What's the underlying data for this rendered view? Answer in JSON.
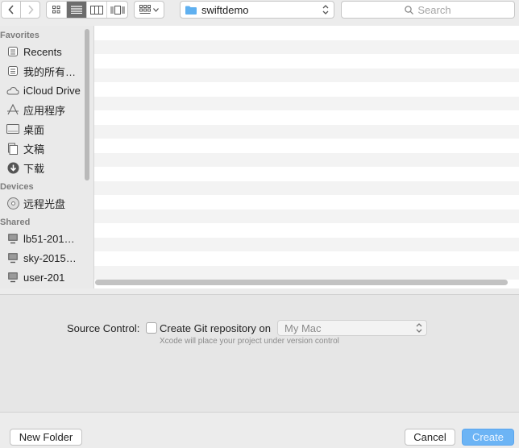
{
  "toolbar": {
    "back_icon": "chevron-left-icon",
    "forward_icon": "chevron-right-icon",
    "view_modes": [
      "icon-view-icon",
      "list-view-icon",
      "column-view-icon",
      "coverflow-view-icon"
    ],
    "active_view": "list-view-icon",
    "arrange_icon": "grid-arrange-icon",
    "path_label": "swiftdemo",
    "search_placeholder": "Search"
  },
  "sidebar": {
    "sections": [
      {
        "title": "Favorites",
        "items": [
          {
            "label": "Recents",
            "icon": "recents-icon"
          },
          {
            "label": "我的所有…",
            "icon": "all-files-icon"
          },
          {
            "label": "iCloud Drive",
            "icon": "cloud-icon"
          },
          {
            "label": "应用程序",
            "icon": "applications-icon"
          },
          {
            "label": "桌面",
            "icon": "desktop-icon"
          },
          {
            "label": "文稿",
            "icon": "documents-icon"
          },
          {
            "label": "下载",
            "icon": "downloads-icon"
          }
        ]
      },
      {
        "title": "Devices",
        "items": [
          {
            "label": "远程光盘",
            "icon": "disc-icon"
          }
        ]
      },
      {
        "title": "Shared",
        "items": [
          {
            "label": "lb51-201…",
            "icon": "computer-icon"
          },
          {
            "label": "sky-2015…",
            "icon": "computer-icon"
          },
          {
            "label": "user-201",
            "icon": "computer-icon"
          }
        ]
      }
    ]
  },
  "options": {
    "source_control_label": "Source Control:",
    "git_checkbox_label": "Create Git repository on",
    "git_checked": false,
    "location_value": "My Mac",
    "hint": "Xcode will place your project under version control"
  },
  "buttons": {
    "new_folder": "New Folder",
    "cancel": "Cancel",
    "create": "Create"
  },
  "colors": {
    "accent": "#6cb4f5",
    "folder": "#5fb0f0"
  }
}
